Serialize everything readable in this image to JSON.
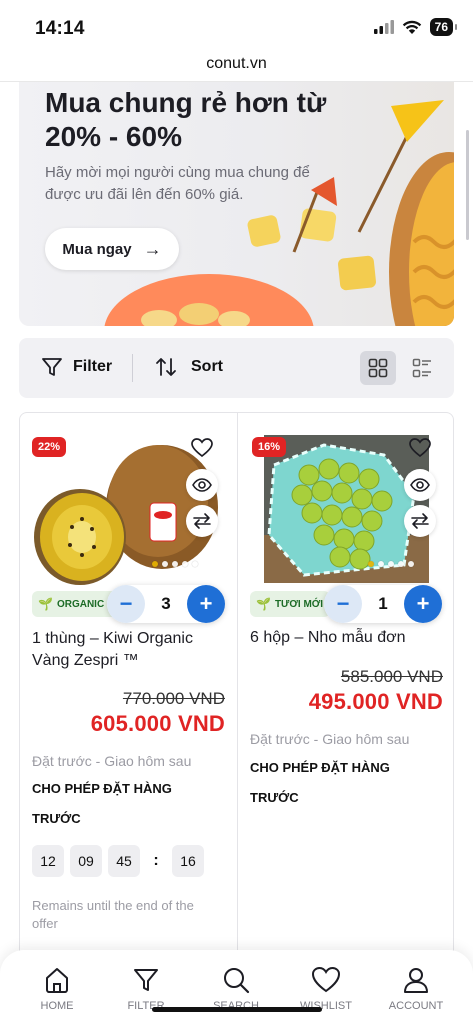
{
  "status_bar": {
    "time": "14:14",
    "battery": "76"
  },
  "browser": {
    "url": "conut.vn"
  },
  "hero": {
    "title": "Mua chung rẻ hơn từ 20% - 60%",
    "subtitle": "Hãy mời mọi người cùng mua chung để được ưu đãi lên đến 60% giá.",
    "cta_label": "Mua ngay",
    "cta_arrow": "→"
  },
  "toolbar": {
    "filter_label": "Filter",
    "sort_label": "Sort"
  },
  "products": [
    {
      "discount": "22%",
      "tag": "ORGANIC",
      "quantity": "3",
      "name": "1 thùng – Kiwi Organic Vàng Zespri ™",
      "old_price": "770.000 VND",
      "new_price": "605.000 VND",
      "shipping": "Đặt trước - Giao hôm sau",
      "preorder": "CHO PHÉP ĐẶT HÀNG TRƯỚC",
      "countdown": [
        "12",
        "09",
        "45",
        "16"
      ],
      "remains": "Remains until the end of the offer"
    },
    {
      "discount": "16%",
      "tag": "TƯƠI MỚI",
      "quantity": "1",
      "name": "6 hộp – Nho mẫu đơn",
      "old_price": "585.000 VND",
      "new_price": "495.000 VND",
      "shipping": "Đặt trước - Giao hôm sau",
      "preorder": "CHO PHÉP ĐẶT HÀNG TRƯỚC"
    }
  ],
  "bottom_nav": {
    "items": [
      {
        "label": "HOME",
        "icon": "home-icon"
      },
      {
        "label": "FILTER",
        "icon": "filter-icon"
      },
      {
        "label": "SEARCH",
        "icon": "search-icon"
      },
      {
        "label": "WISHLIST",
        "icon": "heart-icon"
      },
      {
        "label": "ACCOUNT",
        "icon": "user-icon"
      }
    ]
  },
  "colors": {
    "accent_blue": "#1f6fd6",
    "sale_red": "#e02424",
    "tag_green": "#1c6b26"
  }
}
